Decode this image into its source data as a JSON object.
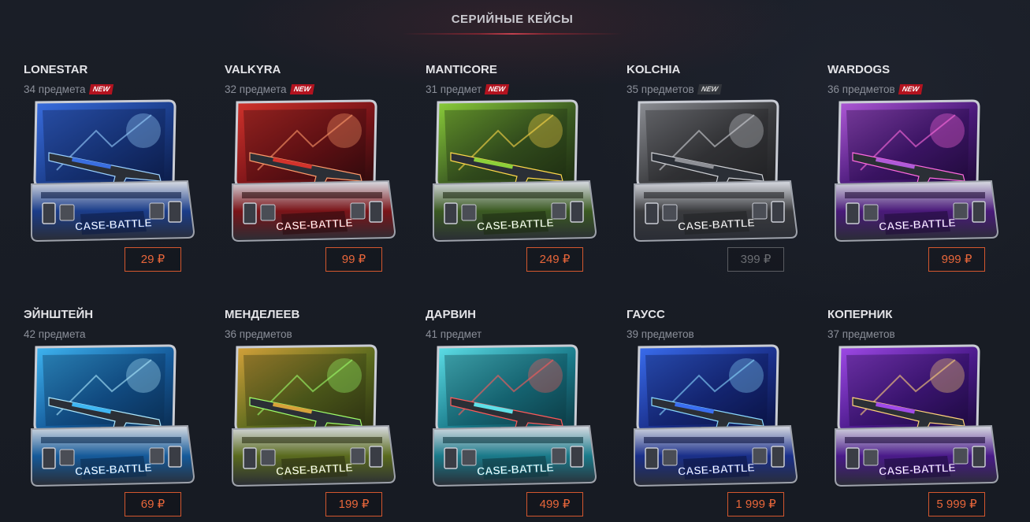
{
  "section": {
    "title": "СЕРИЙНЫЕ КЕЙСЫ"
  },
  "cases": [
    {
      "name": "LONESTAR",
      "count": "34 предмета",
      "badge": "NEW",
      "price": "29 ₽",
      "art": "case-lonestar",
      "colors": [
        "#1b3d8a",
        "#3a6ee0",
        "#0b1a44"
      ],
      "accent": "#9ad0ff"
    },
    {
      "name": "VALKYRA",
      "count": "32 предмета",
      "badge": "NEW",
      "price": "99 ₽",
      "art": "case-valkyra",
      "colors": [
        "#7a1418",
        "#d2332c",
        "#2a0a0c"
      ],
      "accent": "#ff9a6a"
    },
    {
      "name": "MANTICORE",
      "count": "31 предмет",
      "badge": "NEW",
      "price": "249 ₽",
      "art": "case-manticore",
      "colors": [
        "#3b5a22",
        "#8ccf3a",
        "#1c2a10"
      ],
      "accent": "#ffd84a"
    },
    {
      "name": "KOLCHIA",
      "count": "35 предметов",
      "badge": "NEW",
      "price": "399 ₽",
      "art": "case-kolchia",
      "colors": [
        "#3a3b3e",
        "#8e9096",
        "#1f2023"
      ],
      "accent": "#cfd1d6",
      "disabled": true
    },
    {
      "name": "WARDOGS",
      "count": "36 предметов",
      "badge": "NEW",
      "price": "999 ₽",
      "art": "case-wardogs",
      "colors": [
        "#4a1a7a",
        "#b05ad8",
        "#1e0a36"
      ],
      "accent": "#ff6ae0"
    },
    {
      "name": "ЭЙНШТЕЙН",
      "count": "42 предмета",
      "badge": "",
      "price": "69 ₽",
      "art": "case-einstein",
      "colors": [
        "#155a9a",
        "#3fb6f2",
        "#0a2a4e"
      ],
      "accent": "#aee9ff"
    },
    {
      "name": "МЕНДЕЛЕЕВ",
      "count": "36 предметов",
      "badge": "",
      "price": "199 ₽",
      "art": "case-mendeleev",
      "colors": [
        "#5a6a1e",
        "#d6a23a",
        "#2a2e10"
      ],
      "accent": "#9fff6a"
    },
    {
      "name": "ДАРВИН",
      "count": "41 предмет",
      "badge": "",
      "price": "499 ₽",
      "art": "case-darwin",
      "colors": [
        "#1a7a8a",
        "#5ee0e8",
        "#0c3640"
      ],
      "accent": "#ff5a5a"
    },
    {
      "name": "ГАУСС",
      "count": "39 предметов",
      "badge": "",
      "price": "1 999 ₽",
      "art": "case-gauss",
      "colors": [
        "#1a2f8a",
        "#3a6ef0",
        "#0a1240"
      ],
      "accent": "#8ad8ff"
    },
    {
      "name": "КОПЕРНИК",
      "count": "37 предметов",
      "badge": "",
      "price": "5 999 ₽",
      "art": "case-copernicus",
      "colors": [
        "#4a1a8a",
        "#a04ae8",
        "#1a0a3a"
      ],
      "accent": "#ffd27a"
    }
  ]
}
